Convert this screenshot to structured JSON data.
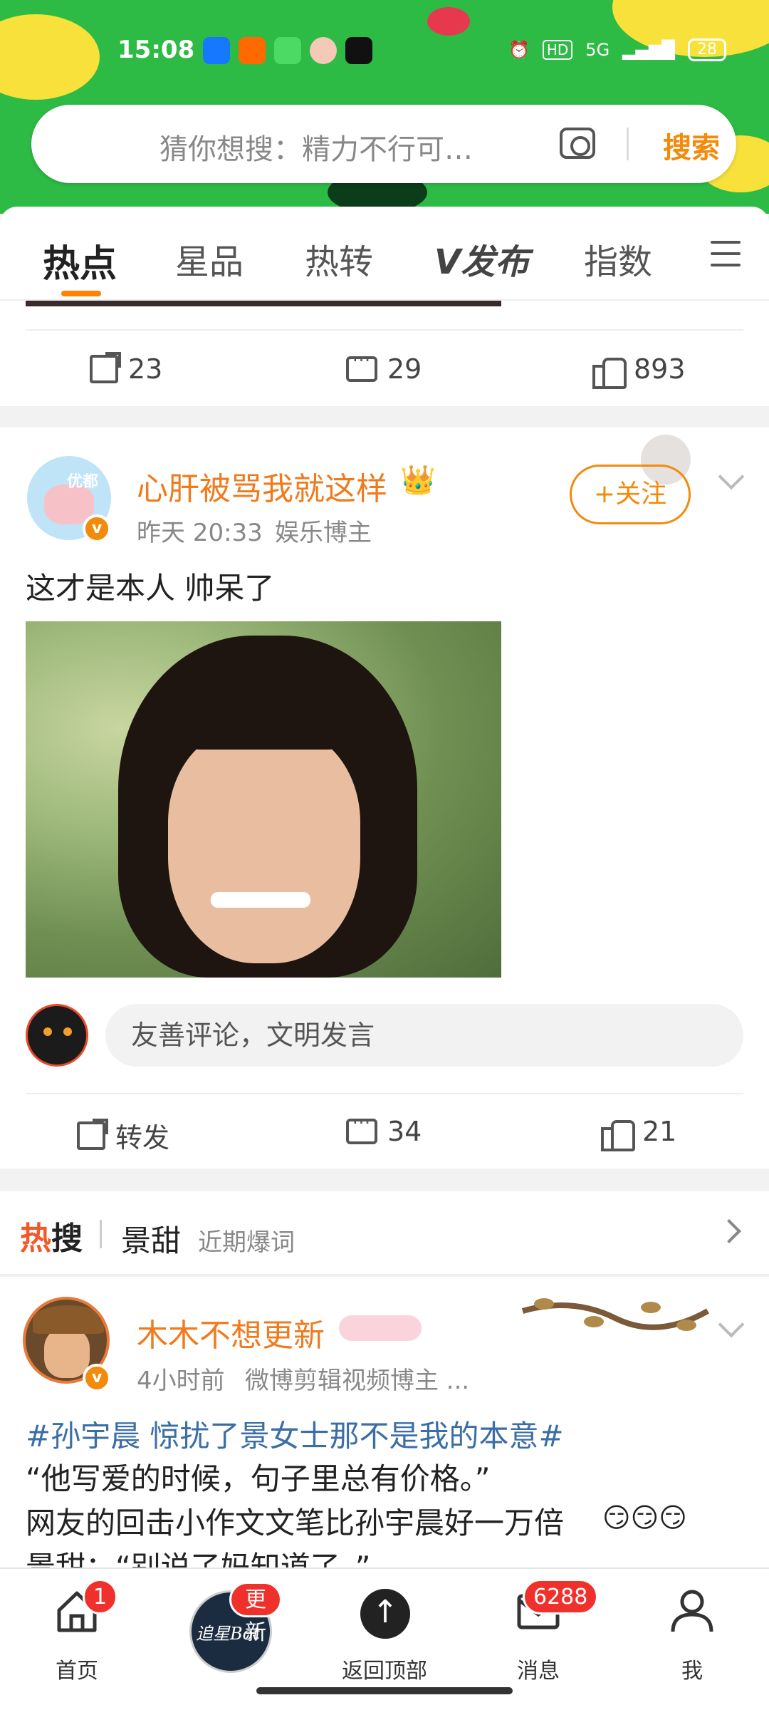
{
  "status_bar": {
    "time": "15:08",
    "network": "5G",
    "hd": "HD",
    "battery": "28"
  },
  "search": {
    "placeholder": "猜你想搜：精力不行可…",
    "button": "搜索"
  },
  "tabs": [
    {
      "label": "热点",
      "active": true
    },
    {
      "label": "星品"
    },
    {
      "label": "热转"
    },
    {
      "label": "V发布"
    },
    {
      "label": "指数"
    }
  ],
  "post0": {
    "shares": "23",
    "comments": "29",
    "likes": "893"
  },
  "post1": {
    "username": "心肝被骂我就这样",
    "avatar_text": "优都",
    "time": "昨天 20:33",
    "role": "娱乐博主",
    "follow_label": "+关注",
    "text": "这才是本人 帅呆了",
    "comment_placeholder": "友善评论，文明发言",
    "share_label": "转发",
    "comments": "34",
    "likes": "21"
  },
  "hot_search": {
    "logo_prefix": "热",
    "logo_suffix": "搜",
    "keyword": "景甜",
    "tag": "近期爆词"
  },
  "post2": {
    "username": "木木不想更新",
    "time": "4小时前",
    "role": "微博剪辑视频博主 ...",
    "topic": "#孙宇晨 惊扰了景女士那不是我的本意#",
    "line1": "“他写爱的时候，句子里总有价格。”",
    "line2": "网友的回击小作文文笔比孙宇晨好一万倍",
    "line3": "景甜：“别说了妈知道了。”"
  },
  "bottom_nav": {
    "home": "首页",
    "home_badge": "1",
    "bot_label": "追星Bot",
    "bot_badge": "更新",
    "top": "返回顶部",
    "messages": "消息",
    "messages_badge": "6288",
    "me": "我"
  },
  "colors": {
    "accent": "#f28b0c",
    "username": "#f07a1c",
    "topic": "#3b6ea5",
    "badge": "#f0312b",
    "banner": "#2dbb45"
  }
}
